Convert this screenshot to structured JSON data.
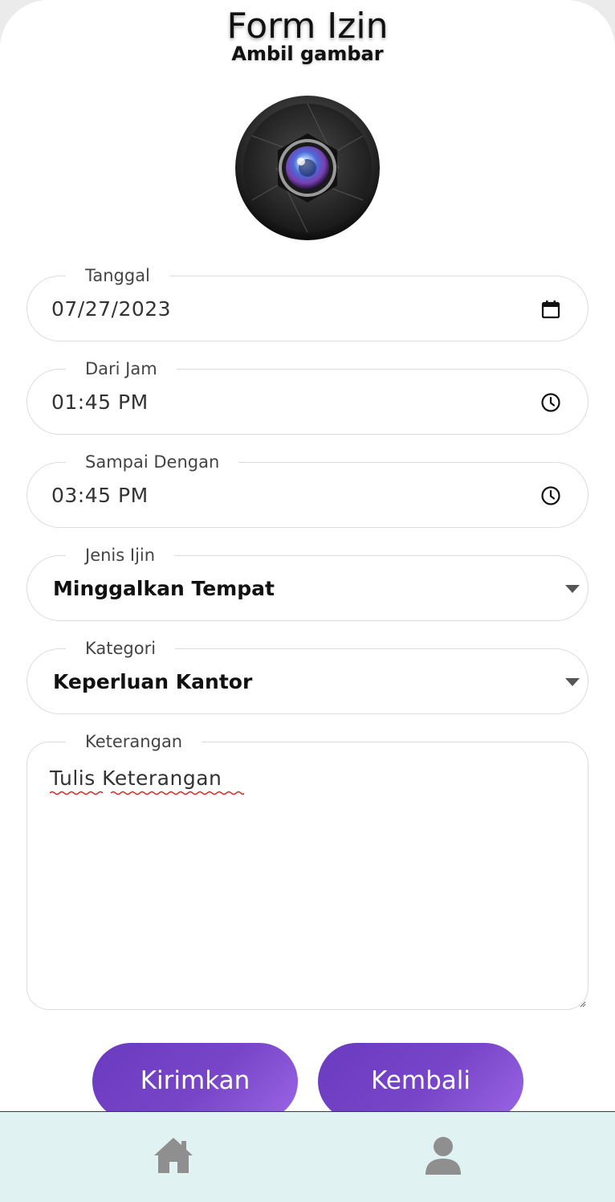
{
  "header": {
    "title": "Form Izin",
    "subtitle": "Ambil gambar"
  },
  "camera": {
    "icon": "camera-lens-icon"
  },
  "form": {
    "tanggal": {
      "label": "Tanggal",
      "value": "07/27/2023",
      "icon": "calendar-icon"
    },
    "dari_jam": {
      "label": "Dari Jam",
      "value": "01:45 PM",
      "icon": "clock-icon"
    },
    "sampai_dengan": {
      "label": "Sampai Dengan",
      "value": "03:45 PM",
      "icon": "clock-icon"
    },
    "jenis_ijin": {
      "label": "Jenis Ijin",
      "value": "Minggalkan Tempat",
      "icon": "caret-down-icon"
    },
    "kategori": {
      "label": "Kategori",
      "value": "Keperluan Kantor",
      "icon": "caret-down-icon"
    },
    "keterangan": {
      "label": "Keterangan",
      "value": "Tulis Keterangan"
    }
  },
  "buttons": {
    "submit": "Kirimkan",
    "back": "Kembali"
  },
  "colors": {
    "button_start": "#6a3bbf",
    "button_end": "#9a66e6",
    "nav_background": "#e1f2f2",
    "nav_icon": "#8f8f8f"
  },
  "nav": {
    "items": [
      {
        "icon": "home-icon"
      },
      {
        "icon": "user-icon"
      }
    ]
  }
}
